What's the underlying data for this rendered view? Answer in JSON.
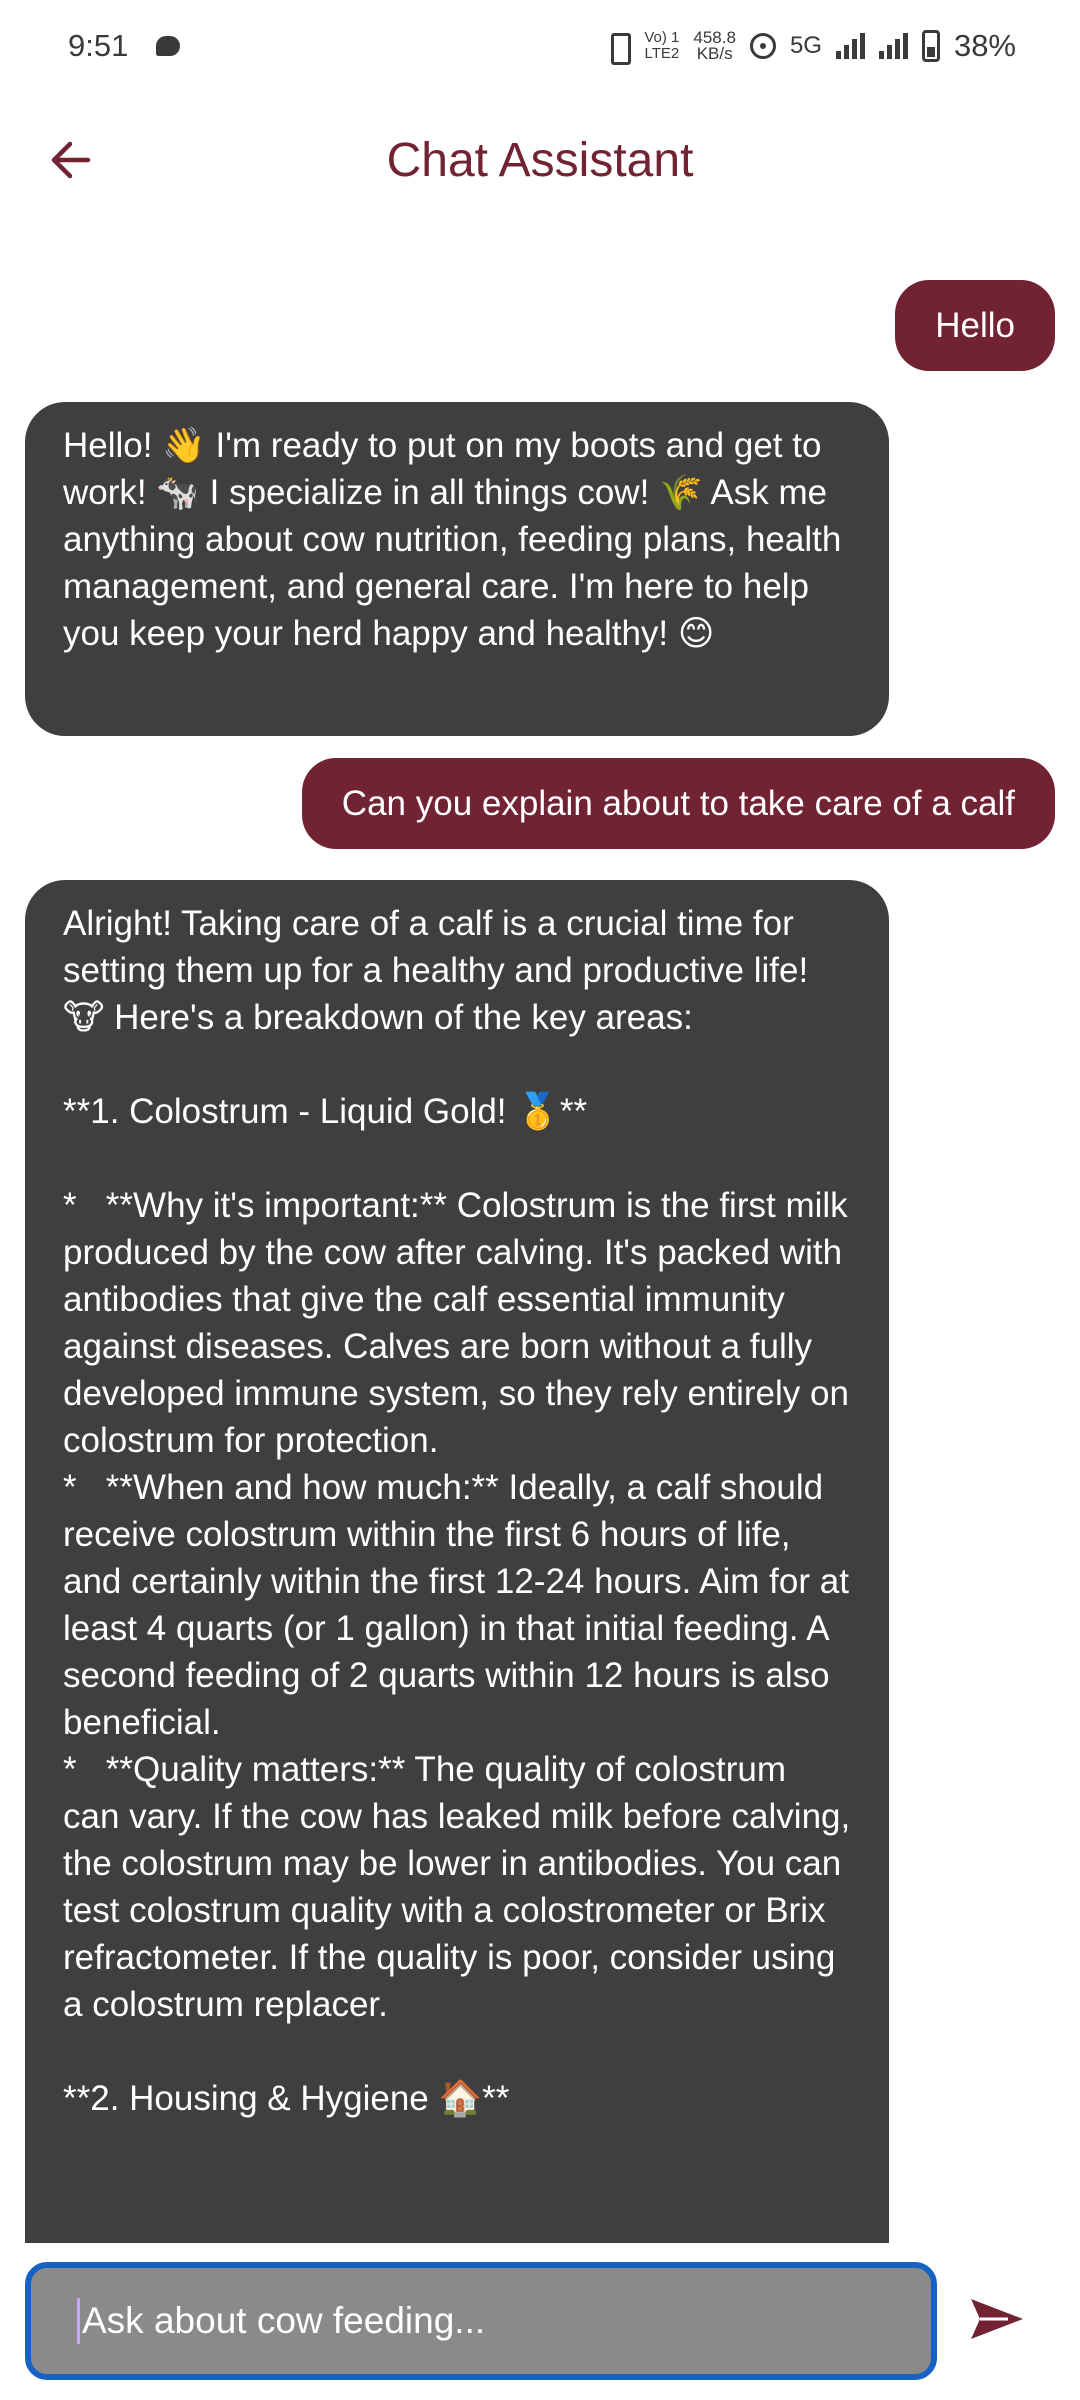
{
  "status_bar": {
    "time": "9:51",
    "network_label_top": "Vo) 1",
    "network_label_bottom": "LTE2",
    "speed_top": "458.8",
    "speed_bottom": "KB/s",
    "network_type": "5G",
    "battery": "38%"
  },
  "header": {
    "title": "Chat Assistant"
  },
  "messages": [
    {
      "role": "user",
      "text": "Hello"
    },
    {
      "role": "assistant",
      "text": "Hello! 👋 I'm ready to put on my boots and get to work! 🐄 I specialize in all things cow! 🌾 Ask me anything about cow nutrition, feeding plans, health management, and general care. I'm here to help you keep your herd happy and healthy! 😊"
    },
    {
      "role": "user",
      "text": "Can you explain about to take care of a calf"
    },
    {
      "role": "assistant",
      "text": "Alright! Taking care of a calf is a crucial time for setting them up for a healthy and productive life! 🐮 Here's a breakdown of the key areas:\n\n**1. Colostrum - Liquid Gold! 🥇**\n\n*   **Why it's important:** Colostrum is the first milk produced by the cow after calving. It's packed with antibodies that give the calf essential immunity against diseases. Calves are born without a fully developed immune system, so they rely entirely on colostrum for protection.\n*   **When and how much:** Ideally, a calf should receive colostrum within the first 6 hours of life, and certainly within the first 12-24 hours. Aim for at least 4 quarts (or 1 gallon) in that initial feeding. A second feeding of 2 quarts within 12 hours is also beneficial.\n*   **Quality matters:** The quality of colostrum can vary. If the cow has leaked milk before calving, the colostrum may be lower in antibodies. You can test colostrum quality with a colostrometer or Brix refractometer. If the quality is poor, consider using a colostrum replacer.\n\n**2. Housing & Hygiene 🏠**"
    }
  ],
  "input": {
    "placeholder": "Ask about cow feeding..."
  },
  "colors": {
    "accent": "#722333",
    "bot_bubble": "#3f3f3f",
    "input_border": "#1662c4"
  },
  "icons": {
    "back": "arrow-left-icon",
    "send": "send-icon"
  }
}
